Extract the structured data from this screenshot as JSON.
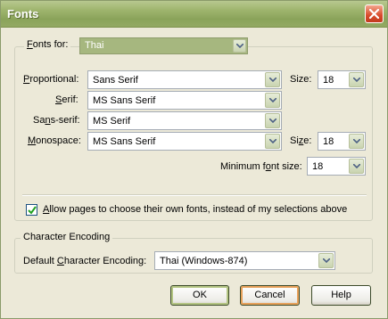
{
  "window": {
    "title": "Fonts"
  },
  "fonts_for": {
    "label": "Fonts for:",
    "value": "Thai"
  },
  "proportional": {
    "label": "Proportional:",
    "value": "Sans Serif",
    "size_label": "Size:",
    "size": "18"
  },
  "serif": {
    "label": "Serif:",
    "value": "MS Sans Serif"
  },
  "sans_serif": {
    "label": "Sans-serif:",
    "value": "MS Serif"
  },
  "monospace": {
    "label": "Monospace:",
    "value": "MS Sans Serif",
    "size_label": "Size:",
    "size": "18"
  },
  "minimum": {
    "label": "Minimum font size:",
    "size": "18"
  },
  "allow_pages": {
    "label": "Allow pages to choose their own fonts, instead of my selections above",
    "checked": true
  },
  "encoding": {
    "group_label": "Character Encoding",
    "label": "Default Character Encoding:",
    "value": "Thai (Windows-874)"
  },
  "buttons": {
    "ok": "OK",
    "cancel": "Cancel",
    "help": "Help"
  }
}
